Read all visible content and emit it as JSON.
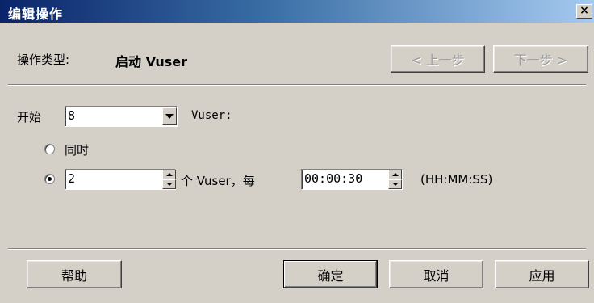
{
  "window": {
    "title": "编辑操作",
    "close_glyph": "×"
  },
  "header": {
    "operation_type_label": "操作类型:",
    "operation_type_value": "启动 Vuser",
    "prev_label": "< 上一步",
    "next_label": "下一步 >"
  },
  "form": {
    "start_label": "开始",
    "start_value": "8",
    "vuser_suffix": "Vuser:",
    "simultaneous_label": "同时",
    "per_value": "2",
    "per_label": "个 Vuser，每",
    "interval_value": "00:00:30",
    "interval_format": "(HH:MM:SS)",
    "selected_option": "incremental"
  },
  "footer": {
    "help_label": "帮助",
    "ok_label": "确定",
    "cancel_label": "取消",
    "apply_label": "应用"
  }
}
